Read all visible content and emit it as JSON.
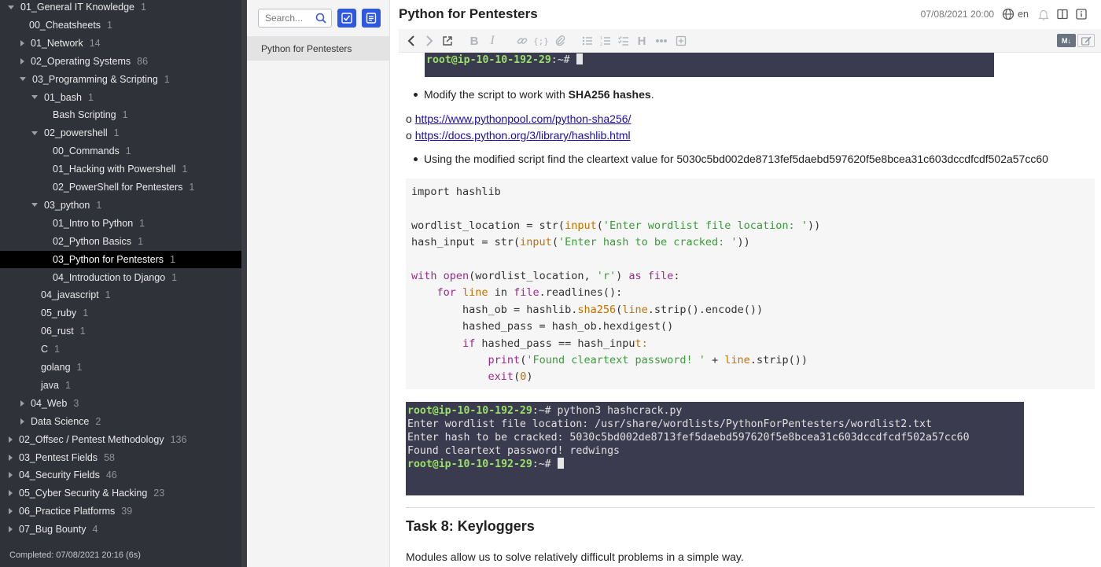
{
  "sidebar": {
    "items": [
      {
        "label": "01_General IT Knowledge",
        "count": "1",
        "caret": "down",
        "indent": 0
      },
      {
        "label": "00_Cheatsheets",
        "count": "1",
        "caret": "none",
        "indent": 1
      },
      {
        "label": "01_Network",
        "count": "14",
        "caret": "right",
        "indent": 1
      },
      {
        "label": "02_Operating Systems",
        "count": "86",
        "caret": "right",
        "indent": 1
      },
      {
        "label": "03_Programming & Scripting",
        "count": "1",
        "caret": "down",
        "indent": 1
      },
      {
        "label": "01_bash",
        "count": "1",
        "caret": "down",
        "indent": 2
      },
      {
        "label": "Bash Scripting",
        "count": "1",
        "caret": "none",
        "indent": 3
      },
      {
        "label": "02_powershell",
        "count": "1",
        "caret": "down",
        "indent": 2
      },
      {
        "label": "00_Commands",
        "count": "1",
        "caret": "none",
        "indent": 3
      },
      {
        "label": "01_Hacking with Powershell",
        "count": "1",
        "caret": "none",
        "indent": 3
      },
      {
        "label": "02_PowerShell for Pentesters",
        "count": "1",
        "caret": "none",
        "indent": 3
      },
      {
        "label": "03_python",
        "count": "1",
        "caret": "down",
        "indent": 2
      },
      {
        "label": "01_Intro to Python",
        "count": "1",
        "caret": "none",
        "indent": 3
      },
      {
        "label": "02_Python Basics",
        "count": "1",
        "caret": "none",
        "indent": 3
      },
      {
        "label": "03_Python for Pentesters",
        "count": "1",
        "caret": "none",
        "indent": 3,
        "active": true
      },
      {
        "label": "04_Introduction to Django",
        "count": "1",
        "caret": "none",
        "indent": 3
      },
      {
        "label": "04_javascript",
        "count": "1",
        "caret": "none",
        "indent": 2
      },
      {
        "label": "05_ruby",
        "count": "1",
        "caret": "none",
        "indent": 2
      },
      {
        "label": "06_rust",
        "count": "1",
        "caret": "none",
        "indent": 2
      },
      {
        "label": "C",
        "count": "1",
        "caret": "none",
        "indent": 2
      },
      {
        "label": "golang",
        "count": "1",
        "caret": "none",
        "indent": 2
      },
      {
        "label": "java",
        "count": "1",
        "caret": "none",
        "indent": 2
      },
      {
        "label": "04_Web",
        "count": "3",
        "caret": "right",
        "indent": 1
      },
      {
        "label": "Data Science",
        "count": "2",
        "caret": "right",
        "indent": 1
      },
      {
        "label": "02_Offsec / Pentest Methodology",
        "count": "136",
        "caret": "right",
        "indent": 0
      },
      {
        "label": "03_Pentest Fields",
        "count": "58",
        "caret": "right",
        "indent": 0
      },
      {
        "label": "04_Security Fields",
        "count": "46",
        "caret": "right",
        "indent": 0
      },
      {
        "label": "05_Cyber Security & Hacking",
        "count": "23",
        "caret": "right",
        "indent": 0
      },
      {
        "label": "06_Practice Platforms",
        "count": "39",
        "caret": "right",
        "indent": 0
      },
      {
        "label": "07_Bug Bounty",
        "count": "4",
        "caret": "right",
        "indent": 0
      }
    ],
    "status": "Completed: 07/08/2021 20:16 (6s)"
  },
  "notelist": {
    "search_placeholder": "Search...",
    "notes": [
      "Python for Pentesters"
    ]
  },
  "editor": {
    "title": "Python for Pentesters",
    "date": "07/08/2021 20:00",
    "lang": "en",
    "toolbar_md_label": "M↓",
    "colors": {
      "terminal_bg": "#3b3b4f",
      "prompt": "#9be06b",
      "accent": "#2f58e0"
    }
  },
  "content": {
    "top_term_prompt": "root@ip-10-10-192-29",
    "top_term_suffix": ":~# ",
    "bullet1_pre": "Modify the script to work with ",
    "bullet1_bold": "SHA256 hashes",
    "bullet1_post": ".",
    "link1_prefix": "o ",
    "link1": "https://www.pythonpool.com/python-sha256/",
    "link2_prefix": "o ",
    "link2": "https://docs.python.org/3/library/hashlib.html",
    "bullet2": "Using the modified script find the cleartext value for 5030c5bd002de8713fef5daebd597620f5e8bcea31c603dccdfcdf502a57cc60",
    "code": {
      "l1": "import hashlib",
      "l3_a": "wordlist_location = str(",
      "l3_fn": "input",
      "l3_b": "(",
      "l3_str": "'Enter wordlist file location: '",
      "l3_c": "))",
      "l4_a": "hash_input = str(",
      "l4_fn": "input",
      "l4_b": "(",
      "l4_str": "'Enter hash to be cracked: '",
      "l4_c": "))",
      "l6_kw1": "with",
      "l6_sp": " ",
      "l6_fn": "open",
      "l6_a": "(wordlist_location, ",
      "l6_str": "'r'",
      "l6_b": ") ",
      "l6_kw2": "as",
      "l6_c": " ",
      "l6_kw3": "file",
      "l6_d": ":",
      "l7_indent": "    ",
      "l7_kw1": "for",
      "l7_sp": " ",
      "l7_var": "line",
      "l7_a": " in ",
      "l7_kw2": "file",
      "l7_b": ".readlines():",
      "l8_indent": "        ",
      "l8_a": "hash_ob = hashlib.",
      "l8_fn": "sha256",
      "l8_b": "(",
      "l8_var": "line",
      "l8_c": ".strip().encode())",
      "l9": "        hashed_pass = hash_ob.hexdigest()",
      "l10_indent": "        ",
      "l10_kw": "if",
      "l10_a": " hashed_pass == hash_inpu",
      "l10_b": "t:",
      "l11_indent": "            ",
      "l11_kw": "print",
      "l11_a": "(",
      "l11_str": "'Found cleartext password! '",
      "l11_b": " + ",
      "l11_var": "line",
      "l11_c": ".strip())",
      "l12_indent": "            ",
      "l12_kw": "exit",
      "l12_a": "(",
      "l12_num": "0",
      "l12_b": ")"
    },
    "term": {
      "prompt": "root@ip-10-10-192-29",
      "suffix1": ":~# python3 hashcrack.py",
      "line2": "Enter wordlist file location: /usr/share/wordlists/PythonForPentesters/wordlist2.txt",
      "line3": "Enter hash to be cracked: 5030c5bd002de8713fef5daebd597620f5e8bcea31c603dccdfcdf502a57cc60",
      "line4": "Found cleartext password! redwings",
      "suffix5": ":~# "
    },
    "task_heading": "Task 8: Keyloggers",
    "paragraph": "Modules allow us to solve relatively difficult problems in a simple way."
  }
}
